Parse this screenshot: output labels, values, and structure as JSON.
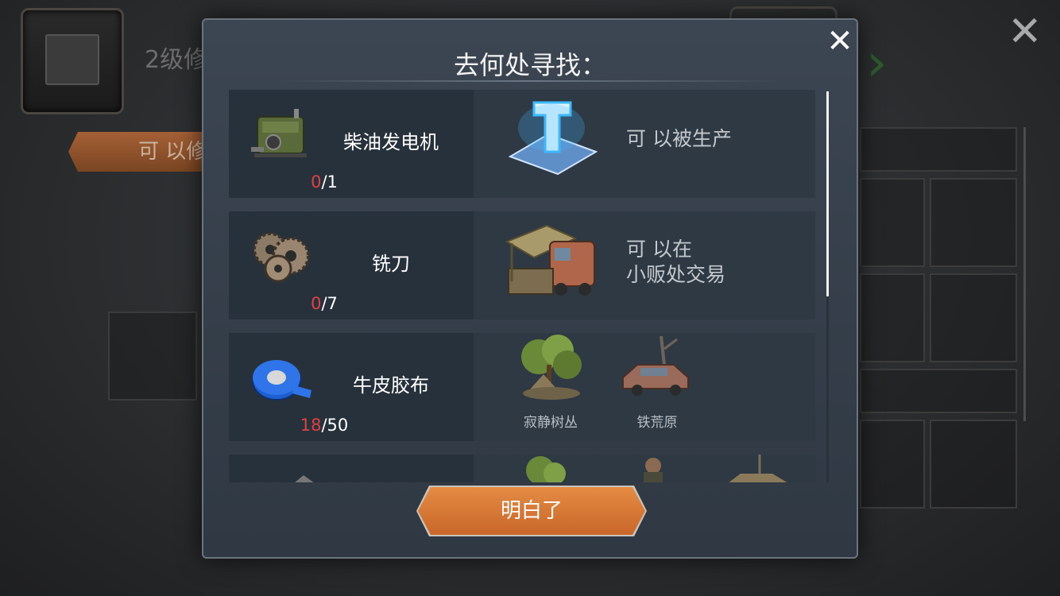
{
  "background": {
    "title": "2级修",
    "button_label": "可 以修"
  },
  "dialog": {
    "title": "去何处寻找：",
    "close_icon": "close-icon",
    "confirm_label": "明白了"
  },
  "items": [
    {
      "name": "柴油发电机",
      "icon": "generator-icon",
      "have": "0",
      "need": "/1",
      "source_icon": "blueprint-icon",
      "source_text_1": "可 以被生产",
      "source_text_2": ""
    },
    {
      "name": "铣刀",
      "icon": "saw-blades-icon",
      "have": "0",
      "need": "/7",
      "source_icon": "trader-stall-icon",
      "source_text_1": "可 以在",
      "source_text_2": "小贩处交易"
    },
    {
      "name": "牛皮胶布",
      "icon": "blue-tape-icon",
      "have": "18",
      "need": "/50",
      "locations": [
        {
          "label": "寂静树丛",
          "icon": "forest-camp-icon"
        },
        {
          "label": "铁荒原",
          "icon": "wrecked-car-icon"
        }
      ]
    }
  ],
  "colors": {
    "shortage": "#e04040",
    "button": "#d9783a"
  }
}
